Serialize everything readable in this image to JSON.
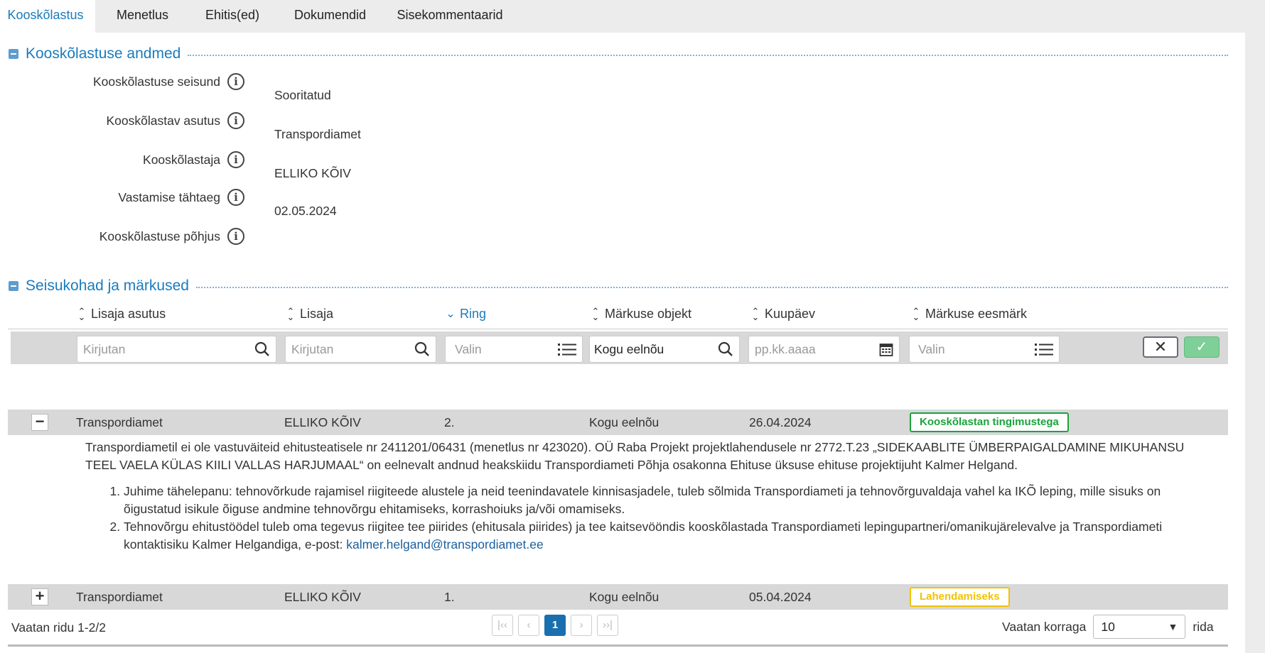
{
  "tabs": [
    {
      "label": "Kooskõlastus",
      "active": true
    },
    {
      "label": "Menetlus"
    },
    {
      "label": "Ehitis(ed)"
    },
    {
      "label": "Dokumendid"
    },
    {
      "label": "Sisekommentaarid"
    }
  ],
  "section1": {
    "title": "Kooskõlastuse andmed",
    "fields": [
      {
        "label": "Kooskõlastuse seisund",
        "value": "Sooritatud"
      },
      {
        "label": "Kooskõlastav asutus",
        "value": "Transpordiamet"
      },
      {
        "label": "Kooskõlastaja",
        "value": "ELLIKO KÕIV"
      },
      {
        "label": "Vastamise tähtaeg",
        "value": "02.05.2024"
      },
      {
        "label": "Kooskõlastuse põhjus",
        "value": ""
      }
    ]
  },
  "section2": {
    "title": "Seisukohad ja märkused"
  },
  "table": {
    "columns": [
      "Lisaja asutus",
      "Lisaja",
      "Ring",
      "Märkuse objekt",
      "Kuupäev",
      "Märkuse eesmärk"
    ],
    "filters": {
      "asutus_placeholder": "Kirjutan",
      "lisaja_placeholder": "Kirjutan",
      "ring_placeholder": "Valin",
      "objekt_value": "Kogu eelnõu",
      "kuupaev_placeholder": "pp.kk.aaaa",
      "eesmark_placeholder": "Valin"
    },
    "rows": [
      {
        "expander": "−",
        "asutus": "Transpordiamet",
        "lisaja": "ELLIKO KÕIV",
        "ring": "2.",
        "objekt": "Kogu eelnõu",
        "kuupaev": "26.04.2024",
        "eesmark": "Kooskõlastan tingimustega",
        "badge_color": "#1aa33c"
      },
      {
        "expander": "+",
        "asutus": "Transpordiamet",
        "lisaja": "ELLIKO KÕIV",
        "ring": "1.",
        "objekt": "Kogu eelnõu",
        "kuupaev": "05.04.2024",
        "eesmark": "Lahendamiseks",
        "badge_color": "#f2c200"
      }
    ],
    "detail": {
      "paragraph": "Transpordiametil ei ole vastuväiteid ehitusteatisele nr 2411201/06431 (menetlus nr 423020). OÜ Raba Projekt projektlahendusele nr 2772.T.23 „SIDEKAABLITE ÜMBERPAIGALDAMINE MIKUHANSU TEEL VAELA KÜLAS KIILI VALLAS HARJUMAAL“ on eelnevalt andnud heakskiidu Transpordiameti Põhja osakonna Ehituse üksuse ehituse projektijuht Kalmer Helgand.",
      "item1": "Juhime tähelepanu: tehnovõrkude rajamisel riigiteede alustele ja neid teenindavatele kinnisasjadele, tuleb sõlmida Transpordiameti ja tehnovõrguvaldaja vahel ka IKÕ leping, mille sisuks on õigustatud isikule õiguse andmine tehnovõrgu ehitamiseks, korrashoiuks ja/või omamiseks.",
      "item2": "Tehnovõrgu ehitustöödel tuleb oma tegevus riigitee tee piirides (ehitusala piirides) ja tee kaitsevööndis kooskõlastada Transpordiameti lepingupartneri/omanikujärelevalve ja Transpordiameti kontaktisiku Kalmer Helgandiga, e-post: ",
      "email": "kalmer.helgand@transpordiamet.ee"
    }
  },
  "footer": {
    "showing": "Vaatan ridu 1-2/2",
    "page": "1",
    "page_size_label": "Vaatan korraga",
    "page_size": "10",
    "rows_label": "rida"
  },
  "icons": {
    "info": "info-icon",
    "search": "search-icon",
    "list": "list-icon",
    "calendar": "calendar-icon",
    "filter": "filter-icon",
    "sort": "sort-icon"
  },
  "colors": {
    "accent": "#1a7bbd",
    "row_bg": "#d8d8d8",
    "ok_button": "#7fcf99"
  }
}
